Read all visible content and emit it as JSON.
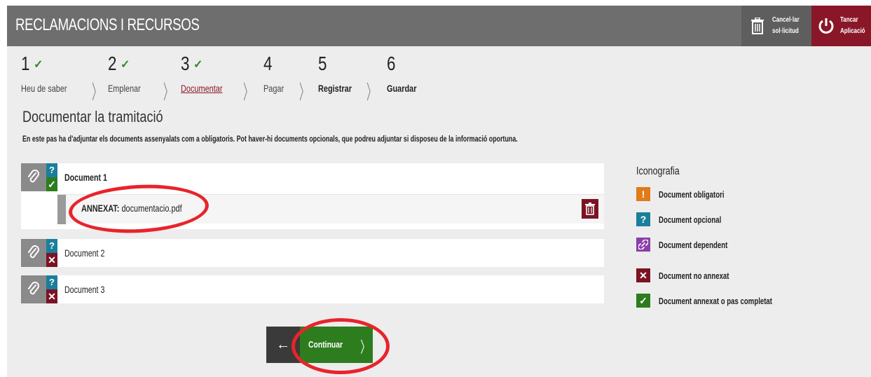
{
  "header": {
    "title": "RECLAMACIONS I RECURSOS",
    "cancel_line1": "Cancel·lar",
    "cancel_line2": "sol·licitud",
    "close_line1": "Tancar",
    "close_line2": "Aplicació"
  },
  "steps": [
    {
      "num": "1",
      "label": "Heu de saber",
      "state": "done"
    },
    {
      "num": "2",
      "label": "Emplenar",
      "state": "done"
    },
    {
      "num": "3",
      "label": "Documentar",
      "state": "current"
    },
    {
      "num": "4",
      "label": "Pagar",
      "state": "pending"
    },
    {
      "num": "5",
      "label": "Registrar",
      "state": "pending"
    },
    {
      "num": "6",
      "label": "Guardar",
      "state": "pending"
    }
  ],
  "section": {
    "title": "Documentar la tramitació",
    "description": "En este pas ha d'adjuntar els documents assenyalats com a obligatoris. Pot haver-hi documents opcionals, que podreu adjuntar si disposeu de la informació oportuna."
  },
  "documents": [
    {
      "name": "Document 1",
      "type": "?",
      "status": "attached",
      "attachment_prefix": "ANNEXAT:",
      "attachment_file": "documentacio.pdf"
    },
    {
      "name": "Document 2",
      "type": "?",
      "status": "missing"
    },
    {
      "name": "Document 3",
      "type": "?",
      "status": "missing"
    }
  ],
  "legend": {
    "title": "Iconografia",
    "items": [
      {
        "label": "Document obligatori",
        "symbol": "!",
        "color": "#e07b1a"
      },
      {
        "label": "Document opcional",
        "symbol": "?",
        "color": "#1a7f9c"
      },
      {
        "label": "Document dependent",
        "symbol": "link-icon",
        "color": "#8b3fa8"
      },
      {
        "label": "Document no annexat",
        "symbol": "✕",
        "color": "#7a1424"
      },
      {
        "label": "Document annexat o pas completat",
        "symbol": "✓",
        "color": "#2d7d1f"
      }
    ]
  },
  "nav": {
    "back_symbol": "←",
    "continue_label": "Continuar",
    "continue_arrow": "〉"
  },
  "colors": {
    "accent": "#8a1728",
    "ok": "#2d7d1f",
    "optional": "#1a7f9c",
    "annotation": "#e8242b"
  }
}
